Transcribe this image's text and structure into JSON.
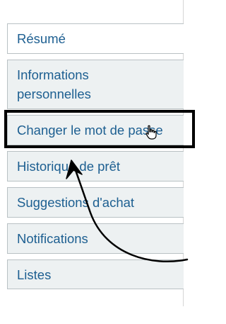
{
  "menu": {
    "items": [
      {
        "label": "Résumé",
        "active": true
      },
      {
        "label": "Informations personnelles",
        "active": false
      },
      {
        "label": "Changer le mot de passe",
        "active": false,
        "highlighted": true
      },
      {
        "label": "Historique de prêt",
        "active": false
      },
      {
        "label": "Suggestions d'achat",
        "active": false
      },
      {
        "label": "Notifications",
        "active": false
      },
      {
        "label": "Listes",
        "active": false
      }
    ]
  },
  "colors": {
    "link": "#1d5f91",
    "item_bg": "#edf1f2",
    "active_bg": "#ffffff",
    "border": "#b9c1c4",
    "annotation": "#000000"
  },
  "annotations": {
    "highlight_box": true,
    "arrow": true,
    "cursor_icon": "hand-pointer-icon"
  }
}
